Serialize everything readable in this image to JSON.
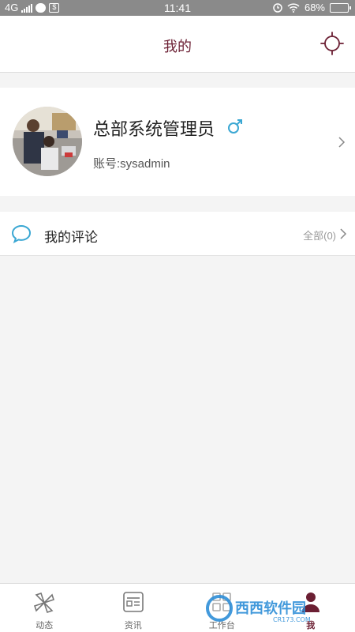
{
  "status_bar": {
    "network": "4G",
    "time": "11:41",
    "battery": "68%"
  },
  "header": {
    "title": "我的"
  },
  "profile": {
    "name": "总部系统管理员",
    "account": "账号:sysadmin"
  },
  "comments": {
    "label": "我的评论",
    "count": "全部(0)"
  },
  "tabs": [
    {
      "label": "动态",
      "icon": "pinwheel-icon"
    },
    {
      "label": "资讯",
      "icon": "news-icon"
    },
    {
      "label": "工作台",
      "icon": "workbench-icon"
    },
    {
      "label": "我",
      "icon": "person-icon",
      "active": true
    }
  ],
  "watermark": {
    "text": "西西软件园",
    "sub": "CR173.COM"
  },
  "colors": {
    "accent": "#6b1f33",
    "gender": "#3aa7d3",
    "comment_icon": "#3aa7d3",
    "status_bar": "#8a8a8a"
  }
}
